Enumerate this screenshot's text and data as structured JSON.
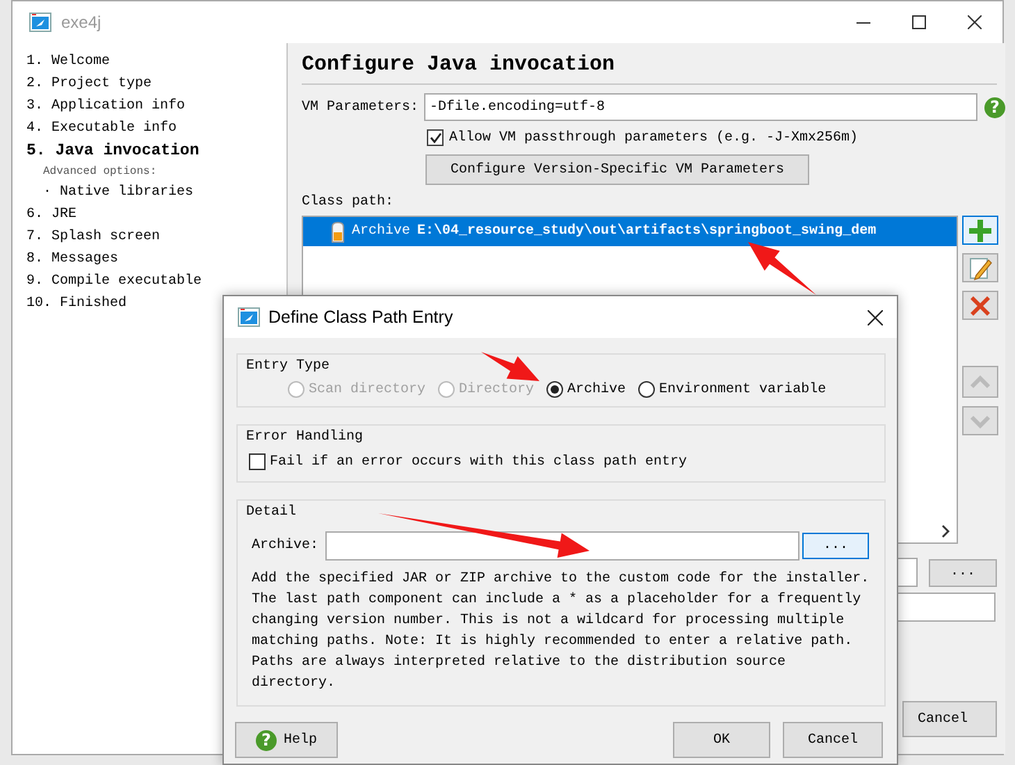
{
  "window": {
    "title": "exe4j"
  },
  "steps": [
    {
      "label": "1. Welcome",
      "selected": false
    },
    {
      "label": "2. Project type",
      "selected": false
    },
    {
      "label": "3. Application info",
      "selected": false
    },
    {
      "label": "4. Executable info",
      "selected": false
    },
    {
      "label": "5. Java invocation",
      "selected": true,
      "advanced_label": "Advanced options:",
      "children": [
        {
          "label": "· Native libraries",
          "selected": false
        }
      ]
    },
    {
      "label": "6. JRE",
      "selected": false
    },
    {
      "label": "7. Splash screen",
      "selected": false
    },
    {
      "label": "8. Messages",
      "selected": false
    },
    {
      "label": "9. Compile executable",
      "selected": false
    },
    {
      "label": "10. Finished",
      "selected": false
    }
  ],
  "page": {
    "heading": "Configure Java invocation",
    "vm_parameters": {
      "label": "VM Parameters:",
      "value": "-Dfile.encoding=utf-8",
      "help_glyph": "?"
    },
    "passthrough": {
      "label": "Allow VM passthrough parameters (e.g. -J-Xmx256m)",
      "checked": true
    },
    "version_button": "Configure Version-Specific VM Parameters",
    "class_path": {
      "label": "Class path:",
      "entries": [
        {
          "type": "Archive",
          "path": "E:\\04_resource_study\\out\\artifacts\\springboot_swing_dem",
          "selected": true
        }
      ]
    },
    "browse_button": "...",
    "cancel_button": "Cancel"
  },
  "dialog": {
    "title": "Define Class Path Entry",
    "entry_type": {
      "legend": "Entry Type",
      "options": [
        {
          "label": "Scan directory",
          "selected": false,
          "disabled": true
        },
        {
          "label": "Directory",
          "selected": false,
          "disabled": true
        },
        {
          "label": "Archive",
          "selected": true,
          "disabled": false
        },
        {
          "label": "Environment variable",
          "selected": false,
          "disabled": false
        }
      ]
    },
    "error_handling": {
      "legend": "Error Handling",
      "option": {
        "label": "Fail if an error occurs with this class path entry",
        "checked": false
      }
    },
    "detail": {
      "legend": "Detail",
      "archive_label": "Archive:",
      "browse_button": "...",
      "description": "Add the specified JAR or ZIP archive to the custom code for the installer. The last path component can include a * as a placeholder for a frequently changing version number. This is not a wildcard for processing multiple matching paths. Note: It is highly recommended to enter a relative path. Paths are always interpreted relative to the distribution source directory."
    },
    "help_button": {
      "glyph": "?",
      "label": "Help"
    },
    "ok_button": "OK",
    "cancel_button": "Cancel"
  }
}
